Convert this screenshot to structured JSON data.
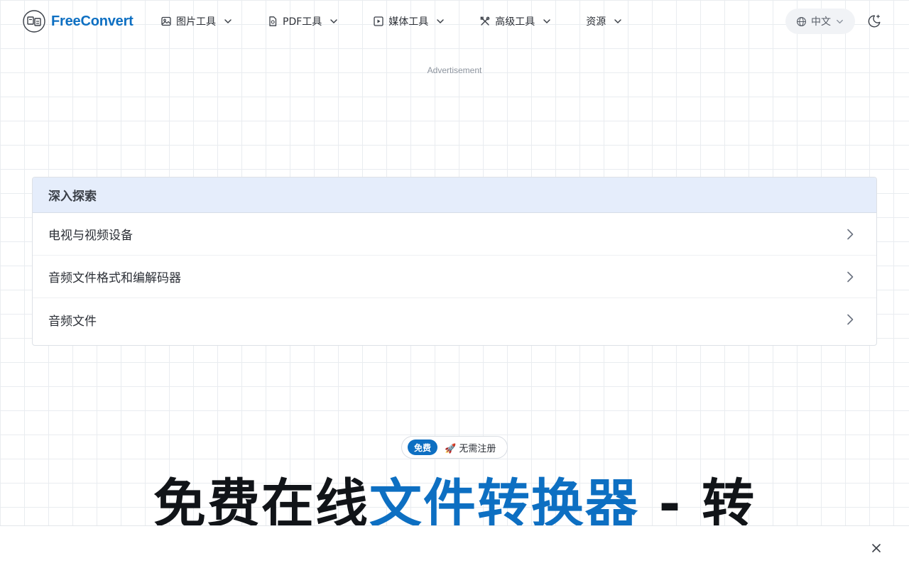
{
  "brand": {
    "name": "FreeConvert",
    "logo_icon": "file-convert-logo-icon"
  },
  "nav": [
    {
      "label": "图片工具",
      "icon": "image-icon"
    },
    {
      "label": "PDF工具",
      "icon": "document-icon"
    },
    {
      "label": "媒体工具",
      "icon": "play-icon"
    },
    {
      "label": "高级工具",
      "icon": "tools-icon"
    },
    {
      "label": "资源",
      "icon": ""
    }
  ],
  "language": {
    "label": "中文",
    "icon": "globe-icon"
  },
  "theme_toggle": {
    "icon": "moon-sparkle-icon"
  },
  "ad": {
    "label": "Advertisement"
  },
  "explore": {
    "title": "深入探索",
    "items": [
      {
        "label": "电视与视频设备"
      },
      {
        "label": "音频文件格式和编解码器"
      },
      {
        "label": "音频文件"
      }
    ]
  },
  "hero": {
    "badge_pill": "免费",
    "badge_text": "🚀 无需注册",
    "title_part1": "免费在线",
    "title_accent": "文件转换器",
    "title_part2": " - 转"
  },
  "bottom_bar": {
    "close_icon": "close-icon"
  },
  "colors": {
    "accent": "#0d6fc2",
    "panel_header": "#e5edfb"
  }
}
